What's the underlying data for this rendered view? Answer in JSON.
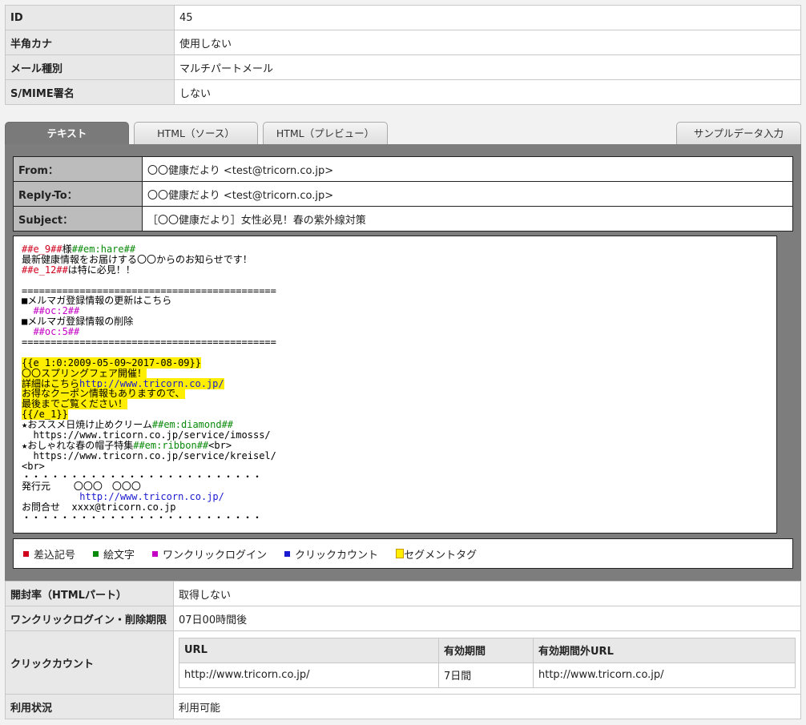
{
  "info": [
    {
      "label": "ID",
      "value": "45"
    },
    {
      "label": "半角カナ",
      "value": "使用しない"
    },
    {
      "label": "メール種別",
      "value": "マルチパートメール"
    },
    {
      "label": "S/MIME署名",
      "value": "しない"
    }
  ],
  "tabs": {
    "text": "テキスト",
    "html_source": "HTML（ソース）",
    "html_preview": "HTML（プレビュー）",
    "sample_data": "サンプルデータ入力"
  },
  "header": [
    {
      "label": "From：",
      "value": "〇〇健康だより <test@tricorn.co.jp>"
    },
    {
      "label": "Reply-To：",
      "value": "〇〇健康だより <test@tricorn.co.jp>"
    },
    {
      "label": "Subject：",
      "value": "［〇〇健康だより］女性必見！春の紫外線対策"
    }
  ],
  "body": {
    "l1_tag": "##e_9##",
    "l1_text": "様",
    "l1_tag2": "##em:hare##",
    "l2": "最新健康情報をお届けする〇〇からのお知らせです！",
    "l3_tag": "##e_12##",
    "l3_text": "は特に必見！！",
    "l4": "",
    "l5": "============================================",
    "l6": "■メルマガ登録情報の更新はこちら",
    "l7": "  ##oc:2##",
    "l8": "■メルマガ登録情報の削除",
    "l9": "  ##oc:5##",
    "l10": "============================================",
    "l11": "",
    "l12": "{{e_1:0:2009-05-09~2017-08-09}}",
    "l13": "〇〇スプリングフェア開催！",
    "l14_a": "詳細はこちら",
    "l14_b": "http://www.tricorn.co.jp/",
    "l15": "お得なクーポン情報もありますので、",
    "l16": "最後までご覧ください！",
    "l17": "{{/e_1}}",
    "l18_a": "★おススメ日焼け止めクリーム",
    "l18_b": "##em:diamond##",
    "l19": "  https://www.tricorn.co.jp/service/imosss/",
    "l20_a": "★おしゃれな春の帽子特集",
    "l20_b": "##em:ribbon##",
    "l20_c": "<br>",
    "l21": "  https://www.tricorn.co.jp/service/kreisel/",
    "l22": "<br>",
    "l23": "・・・・・・・・・・・・・・・・・・・・・・・・・",
    "l24_a": "発行元",
    "l24_b": "〇〇〇　〇〇〇",
    "l25": "http://www.tricorn.co.jp/",
    "l26_a": "お問合せ",
    "l26_b": "xxxx@tricorn.co.jp",
    "l27": "・・・・・・・・・・・・・・・・・・・・・・・・・"
  },
  "legend": {
    "insert": "差込記号",
    "emoji": "絵文字",
    "oneclick": "ワンクリックログイン",
    "clickcount": "クリックカウント",
    "segment": "セグメントタグ",
    "colors": {
      "insert": "#d0001d",
      "emoji": "#0a8a0a",
      "oneclick": "#c400c4",
      "clickcount": "#1a1ad0",
      "segment": "#ffee00"
    }
  },
  "bottom": {
    "open_rate_label": "開封率（HTMLパート）",
    "open_rate_value": "取得しない",
    "oneclick_label": "ワンクリックログイン・削除期限",
    "oneclick_value": "07日00時間後",
    "clickcount_label": "クリックカウント",
    "click_headers": [
      "URL",
      "有効期間",
      "有効期間外URL"
    ],
    "click_row": [
      "http://www.tricorn.co.jp/",
      "7日間",
      "http://www.tricorn.co.jp/"
    ],
    "status_label": "利用状況",
    "status_value": "利用可能"
  }
}
